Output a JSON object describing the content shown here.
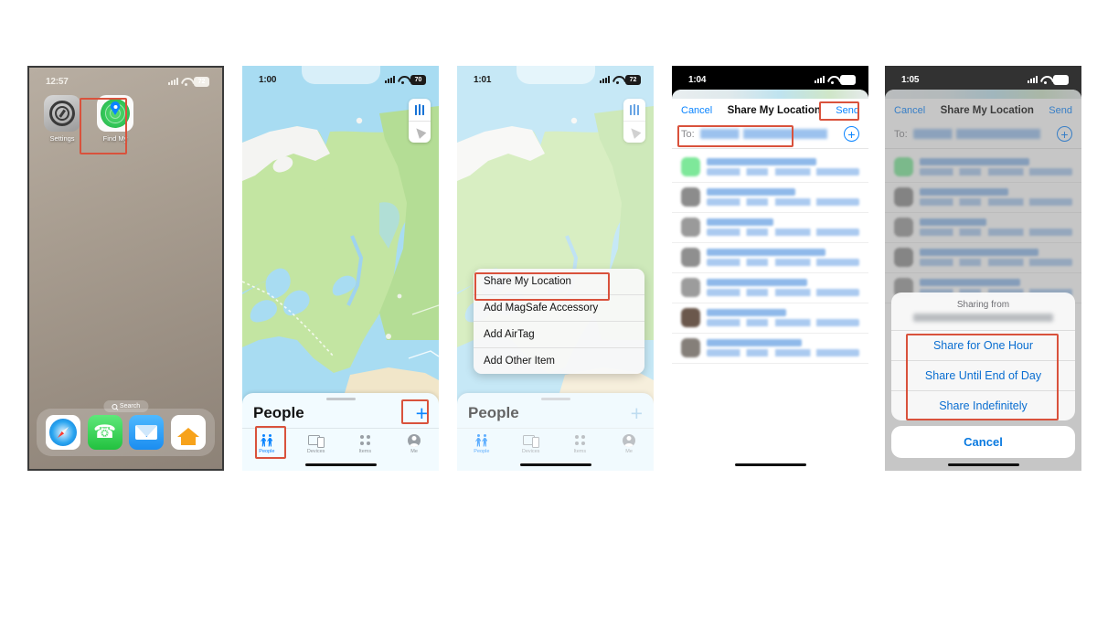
{
  "phones": [
    {
      "id": "home-screen",
      "status": {
        "time": "12:57",
        "battery": "72",
        "signal_icon": "cellular-signal-icon",
        "wifi_icon": "wifi-icon",
        "battery_icon": "battery-icon"
      },
      "apps": [
        {
          "label": "Settings",
          "icon": "settings-gear-icon"
        },
        {
          "label": "Find My",
          "icon": "find-my-icon"
        }
      ],
      "search_pill": "Search",
      "dock": [
        {
          "label": "Safari",
          "icon": "safari-icon"
        },
        {
          "label": "Phone",
          "icon": "phone-icon"
        },
        {
          "label": "Mail",
          "icon": "mail-icon"
        },
        {
          "label": "Home",
          "icon": "home-app-icon"
        }
      ]
    },
    {
      "id": "find-my-people",
      "status": {
        "time": "1:00",
        "battery": "70"
      },
      "map_controls": [
        {
          "name": "map-type-button",
          "icon": "map-book-icon"
        },
        {
          "name": "locate-button",
          "icon": "location-arrow-icon"
        }
      ],
      "sheet": {
        "title": "People",
        "add_label": "+",
        "tabs": [
          {
            "label": "People",
            "icon": "people-icon",
            "active": true
          },
          {
            "label": "Devices",
            "icon": "devices-icon",
            "active": false
          },
          {
            "label": "Items",
            "icon": "items-icon",
            "active": false
          },
          {
            "label": "Me",
            "icon": "me-avatar-icon",
            "active": false
          }
        ]
      }
    },
    {
      "id": "add-menu",
      "status": {
        "time": "1:01",
        "battery": "72"
      },
      "menu": [
        "Share My Location",
        "Add MagSafe Accessory",
        "Add AirTag",
        "Add Other Item"
      ],
      "sheet": {
        "title": "People",
        "add_label": "+",
        "tabs": [
          {
            "label": "People",
            "icon": "people-icon",
            "active": true
          },
          {
            "label": "Devices",
            "icon": "devices-icon",
            "active": false
          },
          {
            "label": "Items",
            "icon": "items-icon",
            "active": false
          },
          {
            "label": "Me",
            "icon": "me-avatar-icon",
            "active": false
          }
        ]
      }
    },
    {
      "id": "share-compose",
      "status": {
        "time": "1:04",
        "battery": "69"
      },
      "nav": {
        "cancel": "Cancel",
        "title": "Share My Location",
        "send": "Send"
      },
      "to_field": {
        "label": "To:",
        "value_redacted": true
      },
      "add_contact_icon": "add-contact-plus-icon",
      "contacts_redacted_count": 7
    },
    {
      "id": "share-duration",
      "status": {
        "time": "1:05",
        "battery": "69"
      },
      "nav": {
        "cancel": "Cancel",
        "title": "Share My Location",
        "send": "Send"
      },
      "to_field": {
        "label": "To:",
        "value_redacted": true
      },
      "add_contact_icon": "add-contact-plus-icon",
      "action_sheet": {
        "header_title": "Sharing from",
        "header_sub_redacted": true,
        "options": [
          "Share for One Hour",
          "Share Until End of Day",
          "Share Indefinitely"
        ],
        "cancel": "Cancel"
      }
    }
  ],
  "highlight_color": "#d9523c"
}
